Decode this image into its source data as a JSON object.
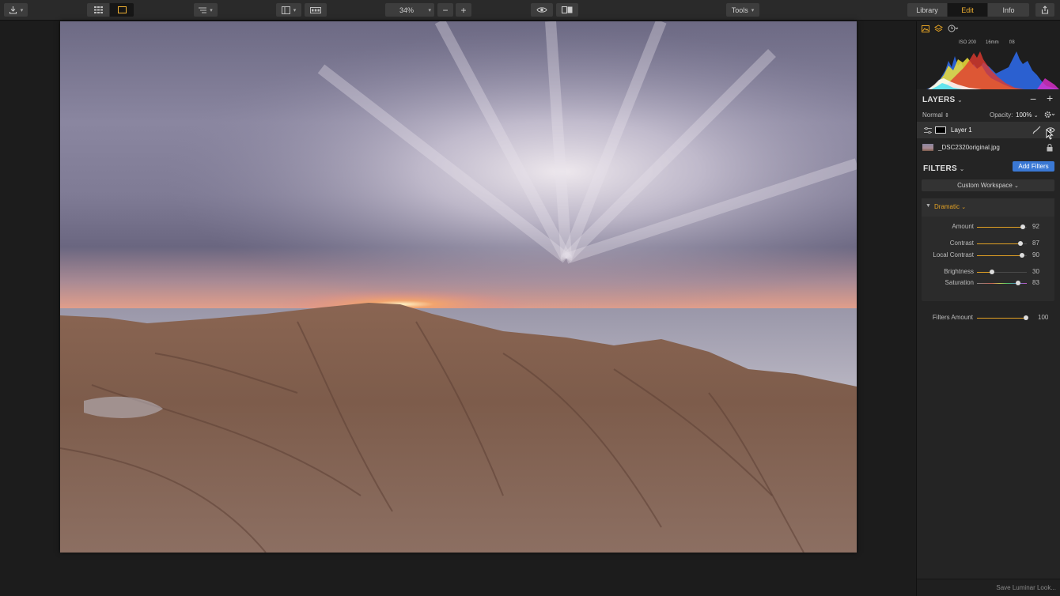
{
  "toolbar": {
    "export_icon": "download-icon",
    "view_grid_icon": "grid-icon",
    "view_single_icon": "single-view-icon",
    "sort_icon": "list-icon",
    "panel_icon": "sidebar-icon",
    "filmstrip_icon": "filmstrip-icon",
    "zoom_value": "34%",
    "zoom_out": "−",
    "zoom_in": "+",
    "preview_icon": "eye-icon",
    "compare_icon": "compare-icon",
    "tools_label": "Tools",
    "mode_tabs": [
      {
        "label": "Library"
      },
      {
        "label": "Edit"
      },
      {
        "label": "Info"
      }
    ],
    "share_icon": "share-icon"
  },
  "panel": {
    "exif": {
      "iso": "ISO 200",
      "focal": "16mm",
      "aperture": "f/8"
    },
    "layers": {
      "title": "LAYERS",
      "blend_mode": "Normal",
      "opacity_label": "Opacity:",
      "opacity_value": "100%",
      "items": [
        {
          "name": "Layer 1"
        },
        {
          "name": "_DSC2320original.jpg"
        }
      ]
    },
    "filters": {
      "title": "FILTERS",
      "add_label": "Add Filters",
      "workspace": "Custom Workspace",
      "filter_name": "Dramatic",
      "sliders": [
        {
          "label": "Amount",
          "value": 92
        },
        {
          "label": "Contrast",
          "value": 87
        },
        {
          "label": "Local Contrast",
          "value": 90
        },
        {
          "label": "Brightness",
          "value": 30
        },
        {
          "label": "Saturation",
          "value": 83
        }
      ],
      "filters_amount": {
        "label": "Filters Amount",
        "value": 100
      }
    },
    "footer_label": "Save Luminar Look..."
  },
  "colors": {
    "accent": "#e2a124",
    "blue": "#3a78d4"
  }
}
